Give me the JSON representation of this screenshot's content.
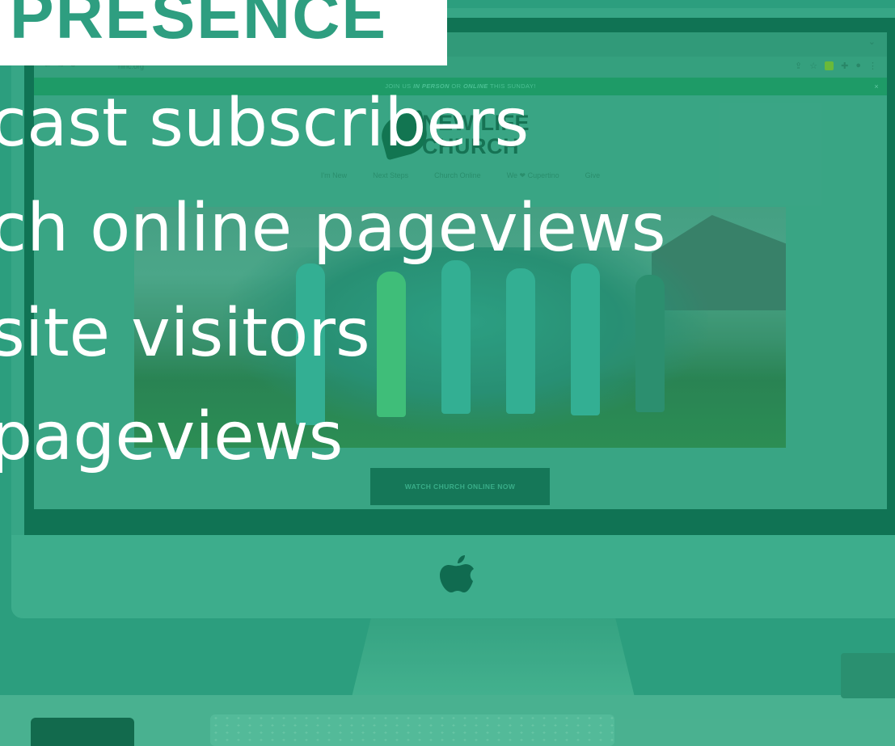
{
  "headline": "PRESENCE",
  "stats": [
    {
      "text": "cast subscribers"
    },
    {
      "text": "ch online pageviews"
    },
    {
      "text": "site visitors"
    },
    {
      "text": " pageviews"
    }
  ],
  "browser": {
    "url": "nlhc.org",
    "banner": {
      "pre": "JOIN US ",
      "in_person": "IN PERSON",
      "mid": " OR ",
      "online": "ONLINE",
      "post": " THIS SUNDAY!",
      "close": "×"
    }
  },
  "site": {
    "logo_line1": "NEW LIFE",
    "logo_line2": "CHURCH",
    "nav": [
      "I'm New",
      "Next Steps",
      "Church Online",
      "We ❤ Cupertino",
      "Give"
    ],
    "cta": "WATCH CHURCH ONLINE NOW"
  },
  "colors": {
    "overlay": "#2e9e80",
    "headline_bg": "#ffffff",
    "headline_text": "#2e9e80",
    "stat_text": "#ffffff"
  },
  "icons": [
    "apple-logo-icon",
    "back-icon",
    "forward-icon",
    "reload-icon",
    "share-icon",
    "star-icon",
    "extension-icon",
    "puzzle-icon",
    "profile-icon",
    "more-icon",
    "chevron-down-icon",
    "close-icon"
  ]
}
